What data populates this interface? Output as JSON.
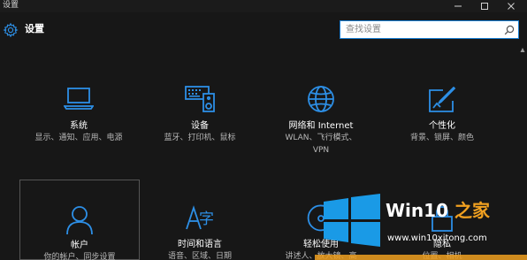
{
  "window": {
    "title": "设置",
    "controls": [
      "minimize-icon",
      "maximize-icon",
      "close-icon"
    ]
  },
  "header": {
    "icon": "gear-icon",
    "title": "设置"
  },
  "search": {
    "placeholder": "查找设置",
    "icon": "search-icon"
  },
  "accent_color": "#2d8fe6",
  "tiles": [
    {
      "label": "系统",
      "description": "显示、通知、应用、电源",
      "icon": "laptop-icon"
    },
    {
      "label": "设备",
      "description": "蓝牙、打印机、鼠标",
      "icon": "devices-icon"
    },
    {
      "label": "网络和 Internet",
      "description": "WLAN、飞行模式、VPN",
      "icon": "globe-icon"
    },
    {
      "label": "个性化",
      "description": "背景、锁屏、颜色",
      "icon": "personalize-icon"
    },
    {
      "label": "帐户",
      "description": "你的帐户、同步设置",
      "icon": "person-icon"
    },
    {
      "label": "时间和语言",
      "description": "语音、区域、日期",
      "icon": "time-language-icon"
    },
    {
      "label": "轻松使用",
      "description": "讲述人、放大镜、高",
      "icon": "ease-of-access-icon"
    },
    {
      "label": "隐私",
      "description": "位置、相机",
      "icon": "lock-icon"
    }
  ],
  "watermark": {
    "brand_prefix": "Win10",
    "brand_suffix": "之家",
    "url": "www.win10xitong.com"
  }
}
